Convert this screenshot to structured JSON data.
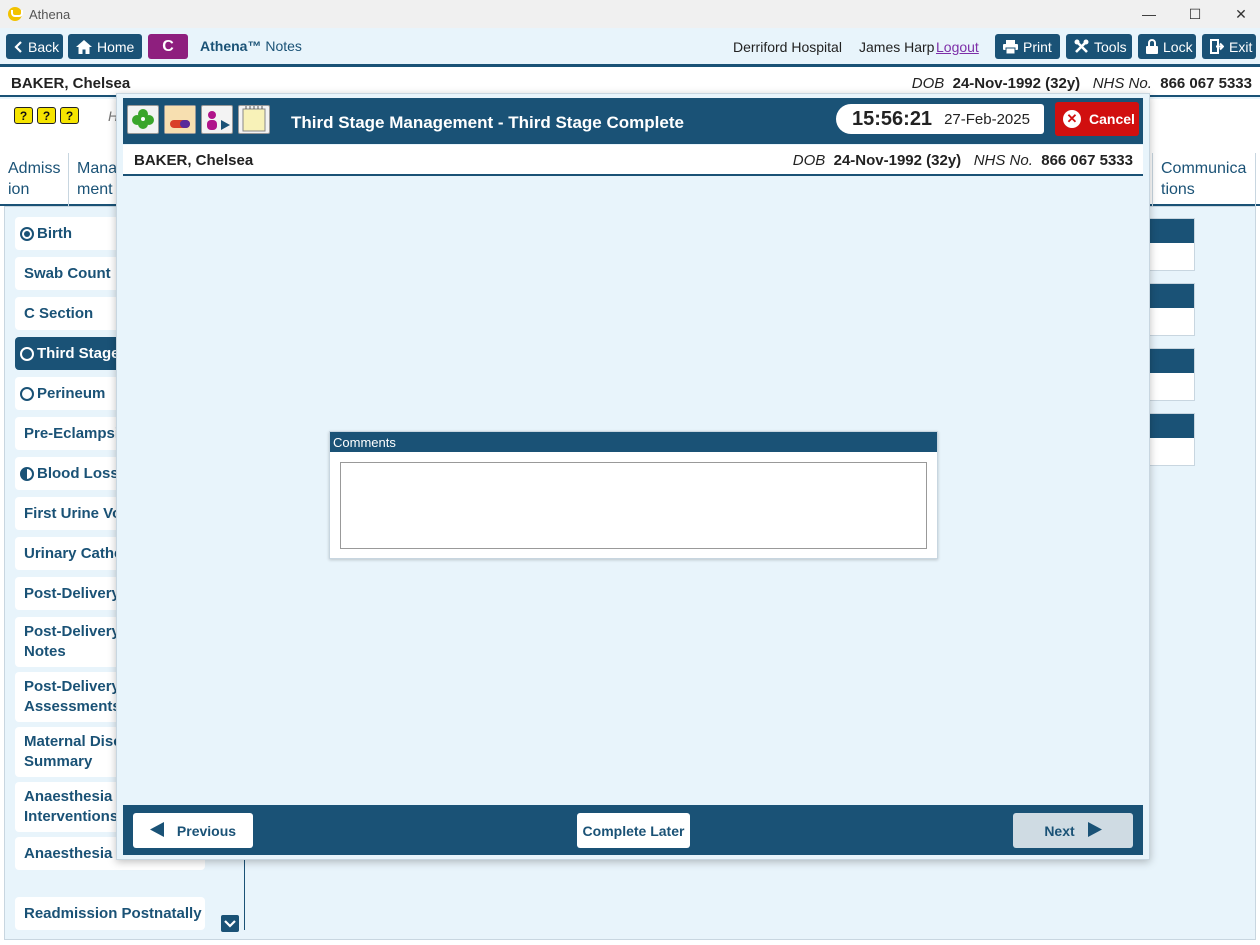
{
  "window": {
    "title": "Athena",
    "controls": [
      "—",
      "☐",
      "✕"
    ]
  },
  "toolbar": {
    "back_label": "Back",
    "home_label": "Home",
    "badge_letter": "C",
    "app_name": "Athena™",
    "app_module": "Notes",
    "hospital": "Derriford Hospital",
    "user": "James Harp",
    "logout_label": "Logout",
    "print_label": "Print",
    "tools_label": "Tools",
    "lock_label": "Lock",
    "exit_label": "Exit"
  },
  "patient": {
    "name": "BAKER, Chelsea",
    "dob_label": "DOB",
    "dob": "24-Nov-1992 (32y)",
    "nhs_label": "NHS No.",
    "nhs": "866 067 5333"
  },
  "background": {
    "quick_icons": [
      "?",
      "?",
      "?"
    ],
    "h_letter": "H",
    "tabs": [
      {
        "line1": "Admiss",
        "line2": "ion"
      },
      {
        "line1": "Mana",
        "line2": "ment"
      },
      {
        "line1": "Communica",
        "line2": "tions"
      }
    ],
    "nav_items": [
      {
        "label": "Birth",
        "radio": "filled",
        "active": false
      },
      {
        "label": "Swab Count",
        "radio": "none",
        "active": false
      },
      {
        "label": "C Section",
        "radio": "none",
        "active": false
      },
      {
        "label": "Third Stage",
        "radio": "empty",
        "active": true
      },
      {
        "label": "Perineum",
        "radio": "empty",
        "active": false
      },
      {
        "label": "Pre-Eclampsia",
        "radio": "none",
        "active": false
      },
      {
        "label": "Blood Loss",
        "radio": "half",
        "active": false
      },
      {
        "label": "First Urine Voi",
        "radio": "none",
        "active": false
      },
      {
        "label": "Urinary Cathe",
        "radio": "none",
        "active": false
      },
      {
        "label": "Post-Delivery",
        "radio": "none",
        "active": false
      },
      {
        "label": "Post-Delivery\nNotes",
        "radio": "none",
        "active": false
      },
      {
        "label": "Post-Delivery\nAssessments",
        "radio": "none",
        "active": false
      },
      {
        "label": "Maternal Disc\nSummary",
        "radio": "none",
        "active": false
      },
      {
        "label": "Anaesthesia\nInterventions",
        "radio": "none",
        "active": false
      },
      {
        "label": "Anaesthesia Fo",
        "radio": "none",
        "active": false
      },
      {
        "label": "Readmission Postnatally",
        "radio": "none",
        "active": false
      }
    ]
  },
  "modal": {
    "title": "Third Stage Management - Third Stage Complete",
    "time": "15:56:21",
    "date": "27-Feb-2025",
    "cancel_label": "Cancel",
    "comments_label": "Comments",
    "comments_value": "",
    "previous_label": "Previous",
    "complete_later_label": "Complete Later",
    "next_label": "Next"
  },
  "colors": {
    "primary": "#1a5276",
    "badge": "#8e1f7e",
    "cancel": "#d10f0f",
    "background": "#e8f4fb"
  }
}
